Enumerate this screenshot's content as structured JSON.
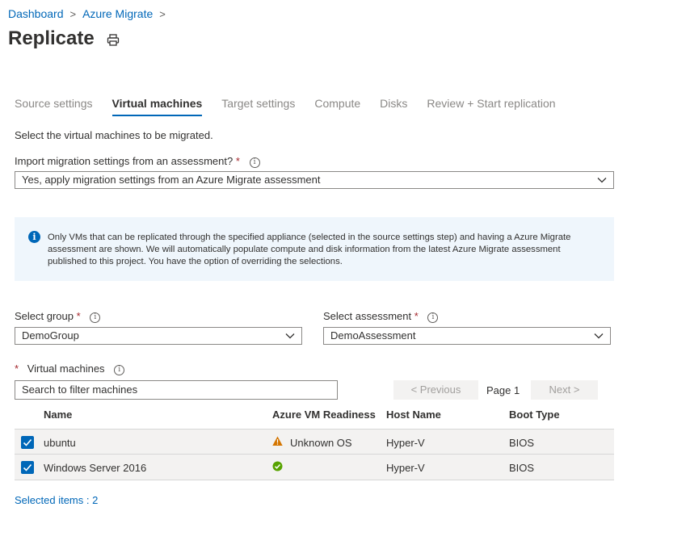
{
  "breadcrumb": {
    "items": [
      "Dashboard",
      "Azure Migrate"
    ]
  },
  "page": {
    "title": "Replicate"
  },
  "tabs": [
    {
      "label": "Source settings"
    },
    {
      "label": "Virtual machines"
    },
    {
      "label": "Target settings"
    },
    {
      "label": "Compute"
    },
    {
      "label": "Disks"
    },
    {
      "label": "Review + Start replication"
    }
  ],
  "active_tab": "Virtual machines",
  "intro": "Select the virtual machines to be migrated.",
  "import_setting": {
    "label": "Import migration settings from an assessment?",
    "required_mark": "*",
    "value": "Yes, apply migration settings from an Azure Migrate assessment"
  },
  "banner": {
    "text": "Only VMs that can be replicated through the specified appliance (selected  in the source settings step) and having a Azure Migrate assessment are shown. We will automatically populate compute and disk information from the latest Azure Migrate assessment published to this project. You have the option of overriding the selections."
  },
  "select_group": {
    "label": "Select group",
    "required_mark": "*",
    "value": "DemoGroup"
  },
  "select_assessment": {
    "label": "Select assessment",
    "required_mark": "*",
    "value": "DemoAssessment"
  },
  "vms": {
    "required_mark": "*",
    "label": "Virtual machines",
    "search_placeholder": "Search to filter machines"
  },
  "pagination": {
    "previous": "< Previous",
    "page": "Page 1",
    "next": "Next >"
  },
  "table": {
    "headers": [
      "Name",
      "Azure VM Readiness",
      "Host Name",
      "Boot Type"
    ],
    "rows": [
      {
        "name": "ubuntu",
        "readiness": "Unknown OS",
        "readiness_icon": "warning-icon",
        "host": "Hyper-V",
        "boot": "BIOS",
        "checked": true
      },
      {
        "name": "Windows Server 2016",
        "readiness": "",
        "readiness_icon": "check-circle-icon",
        "host": "Hyper-V",
        "boot": "BIOS",
        "checked": true
      }
    ]
  },
  "footer": {
    "selected": "Selected items : 2"
  },
  "colors": {
    "accent": "#0067b8",
    "warning": "#d47500",
    "success": "#57a300",
    "required": "#a4262c"
  }
}
